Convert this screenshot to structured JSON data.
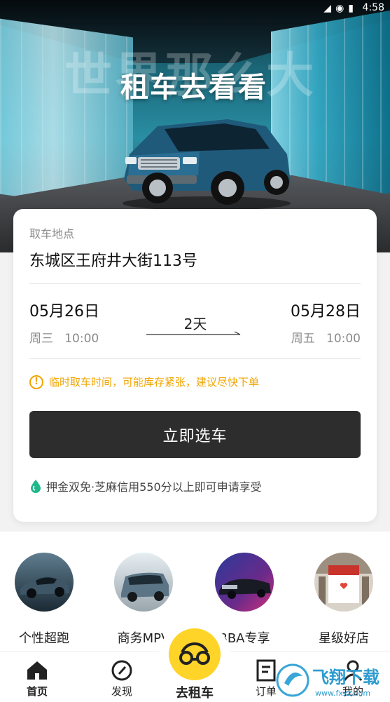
{
  "status_bar": {
    "time": "4:58"
  },
  "hero": {
    "background_text": "世界那么大",
    "slogan": "租车去看看"
  },
  "booking": {
    "pickup_label": "取车地点",
    "pickup_address": "东城区王府井大街113号",
    "start_date": "05月26日",
    "start_weekday_time": "周三   10:00",
    "end_date": "05月28日",
    "end_weekday_time": "周五   10:00",
    "duration": "2天",
    "notice": "临时取车时间，可能库存紧张，建议尽快下单",
    "select_button": "立即选车",
    "deposit_text": "押金双免·芝麻信用550分以上即可申请享受"
  },
  "categories": [
    {
      "label": "个性超跑",
      "icon": "sports-car-photo"
    },
    {
      "label": "商务MPV",
      "icon": "mpv-van-photo"
    },
    {
      "label": "BBA专享",
      "icon": "luxury-sedan-photo"
    },
    {
      "label": "星级好店",
      "icon": "store-front-photo"
    }
  ],
  "nav": {
    "home": "首页",
    "discover": "发现",
    "center": "去租车",
    "orders": "订单",
    "mine": "我的"
  },
  "watermark": {
    "text": "飞翔下载",
    "sub": "www.fxxz.com"
  },
  "colors": {
    "accent_yellow": "#ffd428",
    "warning": "#f0a500",
    "button_dark": "#2d2d2d",
    "green": "#1fb88a"
  }
}
